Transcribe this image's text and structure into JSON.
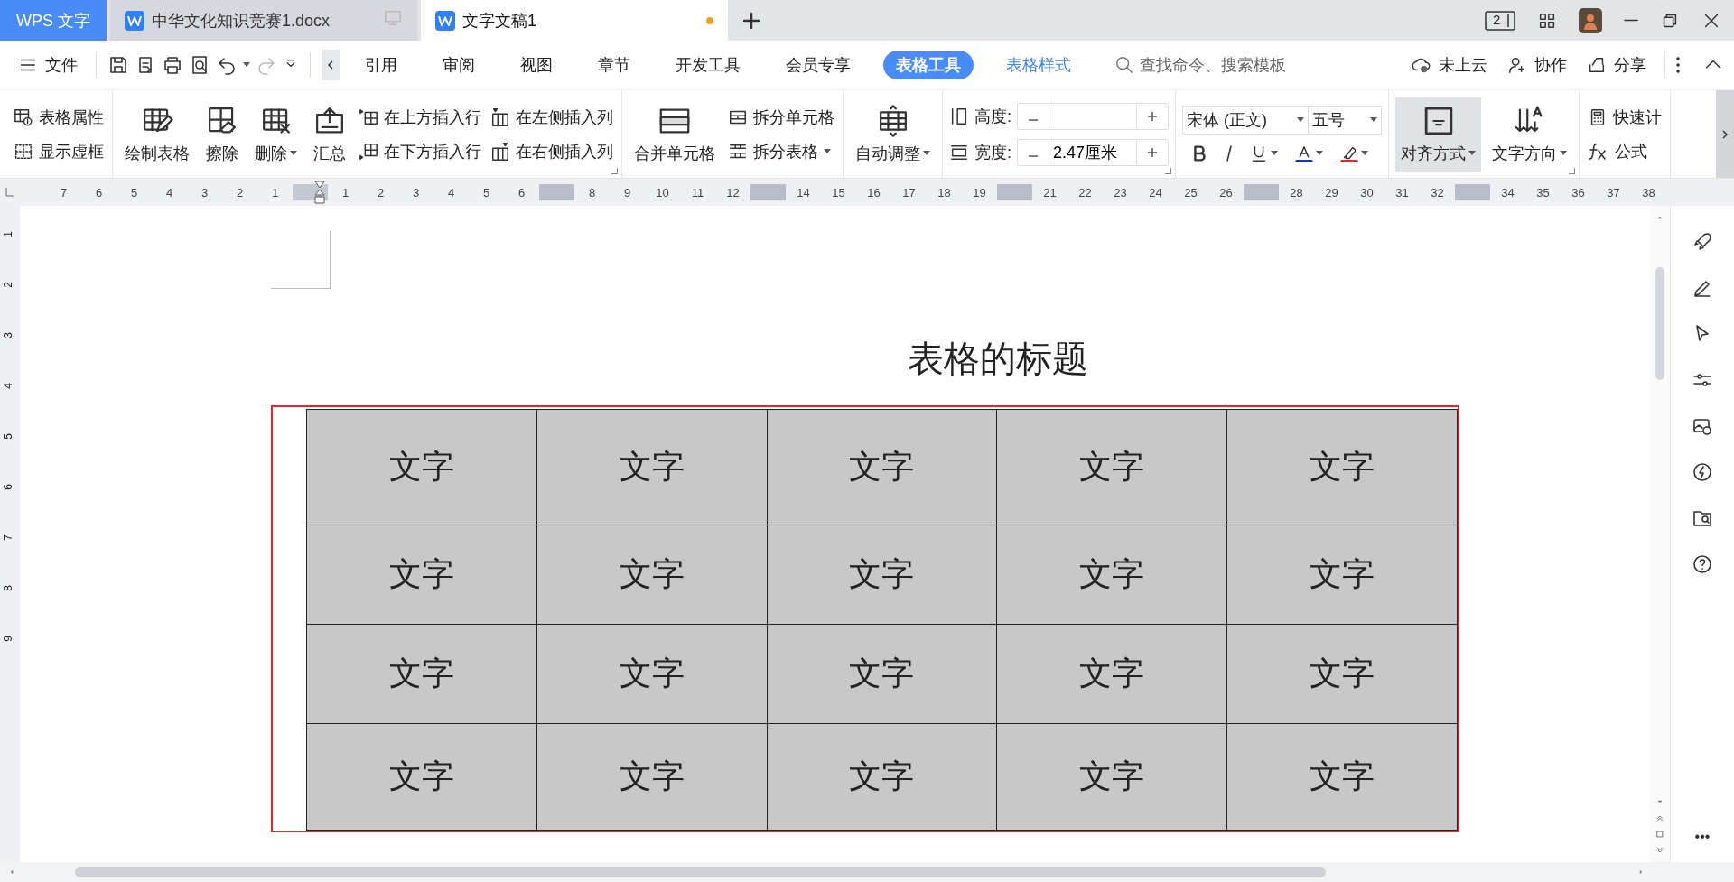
{
  "titlebar": {
    "app_button": "WPS 文字",
    "tabs": [
      {
        "label": "中华文化知识竞赛1.docx",
        "selected": false,
        "modified": false
      },
      {
        "label": "文字文稿1",
        "selected": true,
        "modified": true
      }
    ],
    "window_count": "2"
  },
  "menubar": {
    "file_menu": "文件",
    "tabs": [
      {
        "label": "引用",
        "selected": false,
        "kind": "plain"
      },
      {
        "label": "审阅",
        "selected": false,
        "kind": "plain"
      },
      {
        "label": "视图",
        "selected": false,
        "kind": "plain"
      },
      {
        "label": "章节",
        "selected": false,
        "kind": "plain"
      },
      {
        "label": "开发工具",
        "selected": false,
        "kind": "plain"
      },
      {
        "label": "会员专享",
        "selected": false,
        "kind": "plain"
      },
      {
        "label": "表格工具",
        "selected": true,
        "kind": "context"
      },
      {
        "label": "表格样式",
        "selected": false,
        "kind": "context"
      }
    ],
    "search": {
      "placeholder": "查找命令、搜索模板"
    },
    "actions": [
      "未上云",
      "协作",
      "分享"
    ]
  },
  "ribbon": {
    "groups": [
      {
        "launcher": false,
        "columns": [
          {
            "kind": "stack",
            "items": [
              {
                "label": "表格属性",
                "dropdown": false
              },
              {
                "label": "显示虚框",
                "dropdown": false
              }
            ]
          }
        ]
      },
      {
        "launcher": true,
        "columns": [
          {
            "kind": "large",
            "label": "绘制表格",
            "dropdown": false
          },
          {
            "kind": "large",
            "label": "擦除",
            "dropdown": false
          },
          {
            "kind": "large",
            "label": "删除",
            "dropdown": true
          },
          {
            "kind": "large",
            "label": "汇总",
            "dropdown": false
          },
          {
            "kind": "stack",
            "items": [
              {
                "label": "在上方插入行",
                "dropdown": false
              },
              {
                "label": "在下方插入行",
                "dropdown": false
              }
            ]
          },
          {
            "kind": "stack",
            "items": [
              {
                "label": "在左侧插入列",
                "dropdown": false
              },
              {
                "label": "在右侧插入列",
                "dropdown": false
              }
            ]
          }
        ]
      },
      {
        "launcher": false,
        "columns": [
          {
            "kind": "large",
            "label": "合并单元格",
            "dropdown": false
          },
          {
            "kind": "stack",
            "items": [
              {
                "label": "拆分单元格",
                "dropdown": false
              },
              {
                "label": "拆分表格",
                "dropdown": true
              }
            ]
          }
        ]
      },
      {
        "launcher": false,
        "columns": [
          {
            "kind": "large",
            "label": "自动调整",
            "dropdown": true
          }
        ]
      },
      {
        "launcher": true,
        "columns": [
          {
            "kind": "spin",
            "items": [
              {
                "label": "高度:",
                "value": ""
              },
              {
                "label": "宽度:",
                "value": "2.47厘米"
              }
            ]
          }
        ]
      },
      {
        "launcher": false,
        "columns": [
          {
            "kind": "font",
            "font": "宋体 (正文)",
            "size": "五号"
          }
        ]
      },
      {
        "launcher": true,
        "columns": [
          {
            "kind": "large",
            "label": "对齐方式",
            "dropdown": true,
            "selected": true
          },
          {
            "kind": "large",
            "label": "文字方向",
            "dropdown": true,
            "selected": false
          }
        ]
      },
      {
        "launcher": false,
        "columns": [
          {
            "kind": "stack",
            "items": [
              {
                "label": "快速计",
                "dropdown": false
              },
              {
                "label": "公式",
                "dropdown": false
              }
            ]
          }
        ]
      }
    ]
  },
  "ruler": {
    "marks": [
      {
        "kind": "number",
        "label": "7"
      },
      {
        "kind": "number",
        "label": "6"
      },
      {
        "kind": "number",
        "label": "5"
      },
      {
        "kind": "number",
        "label": "4"
      },
      {
        "kind": "number",
        "label": "3"
      },
      {
        "kind": "number",
        "label": "2"
      },
      {
        "kind": "number",
        "label": "1"
      },
      {
        "kind": "indent"
      },
      {
        "kind": "number",
        "label": "1"
      },
      {
        "kind": "number",
        "label": "2"
      },
      {
        "kind": "number",
        "label": "3"
      },
      {
        "kind": "number",
        "label": "4"
      },
      {
        "kind": "number",
        "label": "5"
      },
      {
        "kind": "number",
        "label": "6"
      },
      {
        "kind": "column"
      },
      {
        "kind": "number",
        "label": "8"
      },
      {
        "kind": "number",
        "label": "9"
      },
      {
        "kind": "number",
        "label": "10"
      },
      {
        "kind": "number",
        "label": "11"
      },
      {
        "kind": "number",
        "label": "12"
      },
      {
        "kind": "column"
      },
      {
        "kind": "number",
        "label": "14"
      },
      {
        "kind": "number",
        "label": "15"
      },
      {
        "kind": "number",
        "label": "16"
      },
      {
        "kind": "number",
        "label": "17"
      },
      {
        "kind": "number",
        "label": "18"
      },
      {
        "kind": "number",
        "label": "19"
      },
      {
        "kind": "column"
      },
      {
        "kind": "number",
        "label": "21"
      },
      {
        "kind": "number",
        "label": "22"
      },
      {
        "kind": "number",
        "label": "23"
      },
      {
        "kind": "number",
        "label": "24"
      },
      {
        "kind": "number",
        "label": "25"
      },
      {
        "kind": "number",
        "label": "26"
      },
      {
        "kind": "column"
      },
      {
        "kind": "number",
        "label": "28"
      },
      {
        "kind": "number",
        "label": "29"
      },
      {
        "kind": "number",
        "label": "30"
      },
      {
        "kind": "number",
        "label": "31"
      },
      {
        "kind": "number",
        "label": "32"
      },
      {
        "kind": "column"
      },
      {
        "kind": "number",
        "label": "34"
      },
      {
        "kind": "number",
        "label": "35"
      },
      {
        "kind": "number",
        "label": "36"
      },
      {
        "kind": "number",
        "label": "37"
      },
      {
        "kind": "number",
        "label": "38"
      }
    ],
    "vertical": [
      "1",
      "2",
      "3",
      "4",
      "5",
      "6",
      "7",
      "8",
      "9"
    ]
  },
  "document": {
    "title": "表格的标题",
    "table": {
      "selected": true,
      "rows": [
        [
          "文字",
          "文字",
          "文字",
          "文字",
          "文字"
        ],
        [
          "文字",
          "文字",
          "文字",
          "文字",
          "文字"
        ],
        [
          "文字",
          "文字",
          "文字",
          "文字",
          "文字"
        ],
        [
          "文字",
          "文字",
          "文字",
          "文字",
          "文字"
        ]
      ]
    }
  },
  "sidebar": {
    "more": "•••"
  }
}
